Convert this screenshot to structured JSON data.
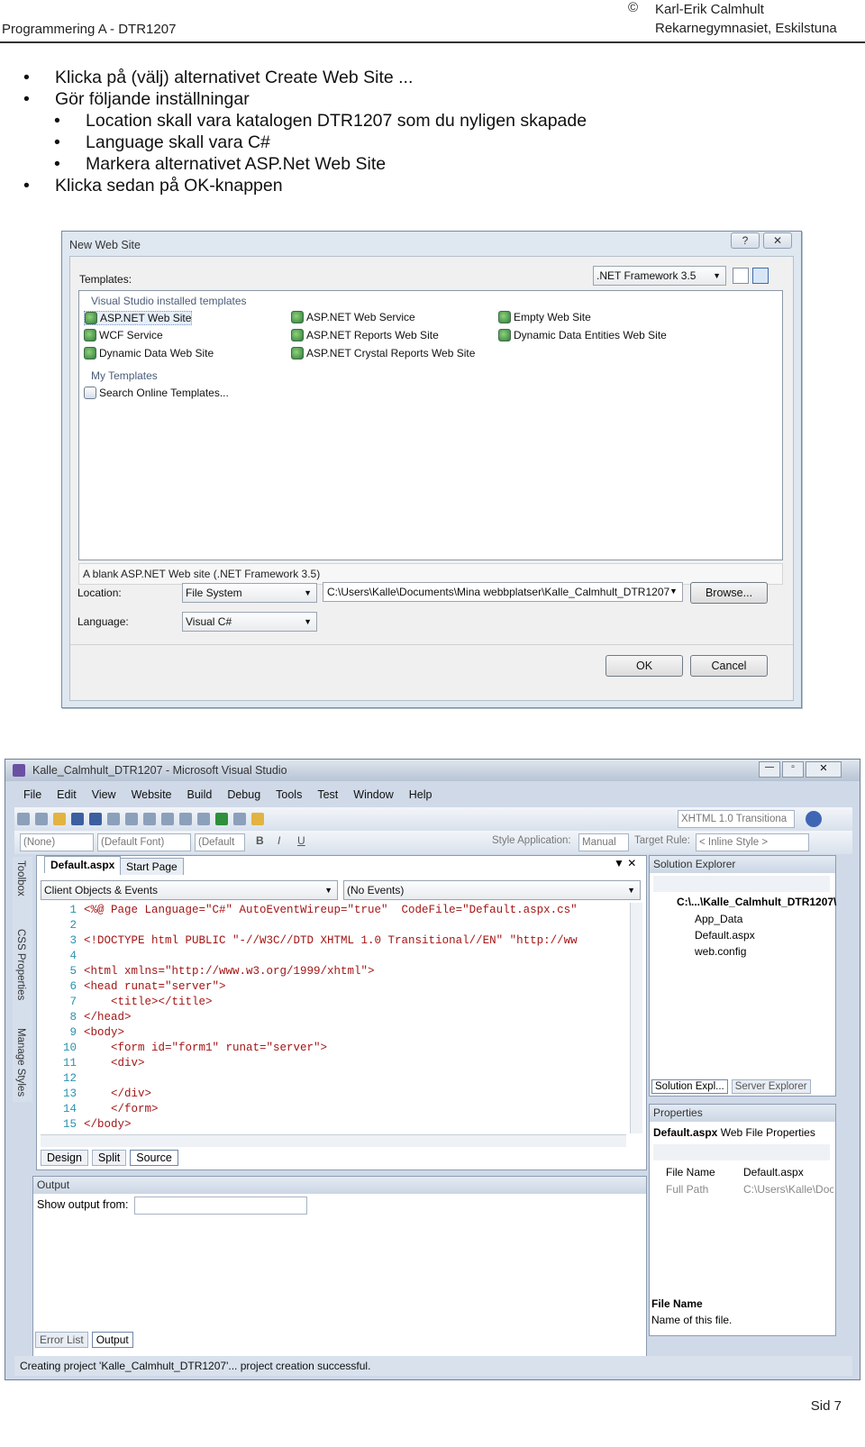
{
  "header": {
    "course": "Programmering A - DTR1207",
    "copyright": "©",
    "author": "Karl-Erik Calmhult",
    "school": "Rekarnegymnasiet, Eskilstuna"
  },
  "bullets": [
    {
      "level": 1,
      "text": "Klicka på (välj) alternativet Create Web Site ..."
    },
    {
      "level": 1,
      "text": "Gör följande inställningar"
    },
    {
      "level": 2,
      "text": "Location skall vara katalogen DTR1207 som du nyligen skapade"
    },
    {
      "level": 2,
      "text": "Language skall vara C#"
    },
    {
      "level": 2,
      "text": "Markera alternativet ASP.Net Web Site"
    },
    {
      "level": 1,
      "text": "Klicka sedan på OK-knappen"
    }
  ],
  "dialog": {
    "title": "New Web Site",
    "help": "?",
    "close": "✕",
    "templates_label": "Templates:",
    "framework": ".NET Framework 3.5",
    "installed_group": "Visual Studio installed templates",
    "templates": [
      {
        "label": "ASP.NET Web Site",
        "selected": true
      },
      {
        "label": "ASP.NET Web Service"
      },
      {
        "label": "Empty Web Site"
      },
      {
        "label": "WCF Service"
      },
      {
        "label": "ASP.NET Reports Web Site"
      },
      {
        "label": "Dynamic Data Entities Web Site"
      },
      {
        "label": "Dynamic Data Web Site"
      },
      {
        "label": "ASP.NET Crystal Reports Web Site"
      }
    ],
    "my_group": "My Templates",
    "search": "Search Online Templates...",
    "description": "A blank ASP.NET Web site (.NET Framework 3.5)",
    "location_label": "Location:",
    "location_type": "File System",
    "location_path": "C:\\Users\\Kalle\\Documents\\Mina webbplatser\\Kalle_Calmhult_DTR1207",
    "browse": "Browse...",
    "language_label": "Language:",
    "language": "Visual C#",
    "ok": "OK",
    "cancel": "Cancel"
  },
  "vs": {
    "title": "Kalle_Calmhult_DTR1207 - Microsoft Visual Studio",
    "menu": [
      "File",
      "Edit",
      "View",
      "Website",
      "Build",
      "Debug",
      "Tools",
      "Test",
      "Window",
      "Help"
    ],
    "doctype_combo": "XHTML 1.0 Transitiona",
    "tb2": {
      "none": "(None)",
      "font": "(Default Font)",
      "size": "(Default",
      "style_app": "Style Application:",
      "manual": "Manual",
      "target_rule": "Target Rule:",
      "inline": "< Inline Style >"
    },
    "side_tabs": [
      "Toolbox",
      "CSS Properties",
      "Manage Styles"
    ],
    "tabs": {
      "active": "Default.aspx",
      "start": "Start Page"
    },
    "client_objects": "Client Objects & Events",
    "no_events": "(No Events)",
    "code": [
      {
        "n": "1",
        "t": "<%@ Page Language=\"C#\" AutoEventWireup=\"true\"  CodeFile=\"Default.aspx.cs\""
      },
      {
        "n": "2",
        "t": ""
      },
      {
        "n": "3",
        "t": "<!DOCTYPE html PUBLIC \"-//W3C//DTD XHTML 1.0 Transitional//EN\" \"http://ww"
      },
      {
        "n": "4",
        "t": ""
      },
      {
        "n": "5",
        "t": "<html xmlns=\"http://www.w3.org/1999/xhtml\">"
      },
      {
        "n": "6",
        "t": "<head runat=\"server\">"
      },
      {
        "n": "7",
        "t": "    <title></title>"
      },
      {
        "n": "8",
        "t": "</head>"
      },
      {
        "n": "9",
        "t": "<body>"
      },
      {
        "n": "10",
        "t": "    <form id=\"form1\" runat=\"server\">"
      },
      {
        "n": "11",
        "t": "    <div>"
      },
      {
        "n": "12",
        "t": ""
      },
      {
        "n": "13",
        "t": "    </div>"
      },
      {
        "n": "14",
        "t": "    </form>"
      },
      {
        "n": "15",
        "t": "</body>"
      }
    ],
    "view_tabs": [
      "Design",
      "Split",
      "Source"
    ],
    "output": {
      "title": "Output",
      "show_from": "Show output from:",
      "tabs": [
        "Error List",
        "Output"
      ]
    },
    "solution": {
      "title": "Solution Explorer",
      "root": "C:\\...\\Kalle_Calmhult_DTR1207\\",
      "items": [
        "App_Data",
        "Default.aspx",
        "web.config"
      ],
      "tabs": [
        "Solution Expl...",
        "Server Explorer"
      ]
    },
    "properties": {
      "title": "Properties",
      "object": "Default.aspx",
      "object_type": "Web File Properties",
      "rows": [
        {
          "k": "File Name",
          "v": "Default.aspx"
        },
        {
          "k": "Full Path",
          "v": "C:\\Users\\Kalle\\Docu"
        }
      ],
      "desc_title": "File Name",
      "desc": "Name of this file."
    },
    "status": "Creating project 'Kalle_Calmhult_DTR1207'... project creation successful."
  },
  "footer": {
    "page": "Sid 7"
  }
}
